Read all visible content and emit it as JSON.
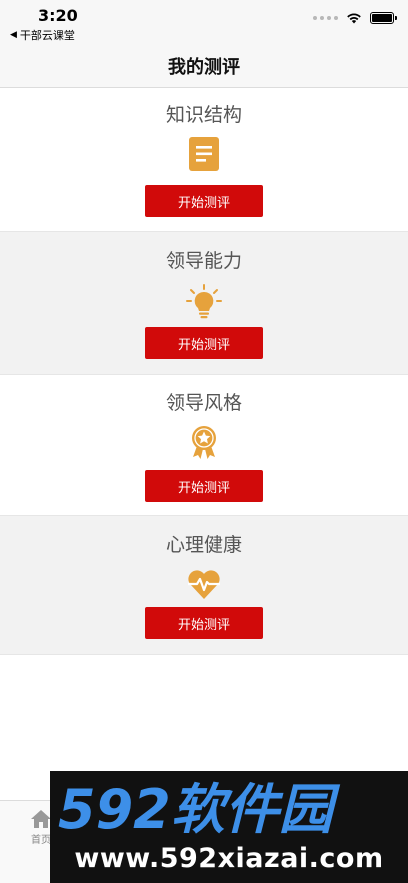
{
  "status": {
    "time": "3:20",
    "back_app": "干部云课堂"
  },
  "nav": {
    "title": "我的测评"
  },
  "sections": [
    {
      "title": "知识结构",
      "icon": "document-icon",
      "button": "开始测评"
    },
    {
      "title": "领导能力",
      "icon": "lightbulb-icon",
      "button": "开始测评"
    },
    {
      "title": "领导风格",
      "icon": "medal-icon",
      "button": "开始测评"
    },
    {
      "title": "心理健康",
      "icon": "heart-pulse-icon",
      "button": "开始测评"
    }
  ],
  "tab_bar": {
    "home_label": "首页"
  },
  "watermark": {
    "logo_text": "592软件园",
    "url": "www.592xiazai.com"
  },
  "colors": {
    "accent": "#d10a0a",
    "icon": "#e6a23c",
    "grey_bg": "#f2f2f2"
  }
}
